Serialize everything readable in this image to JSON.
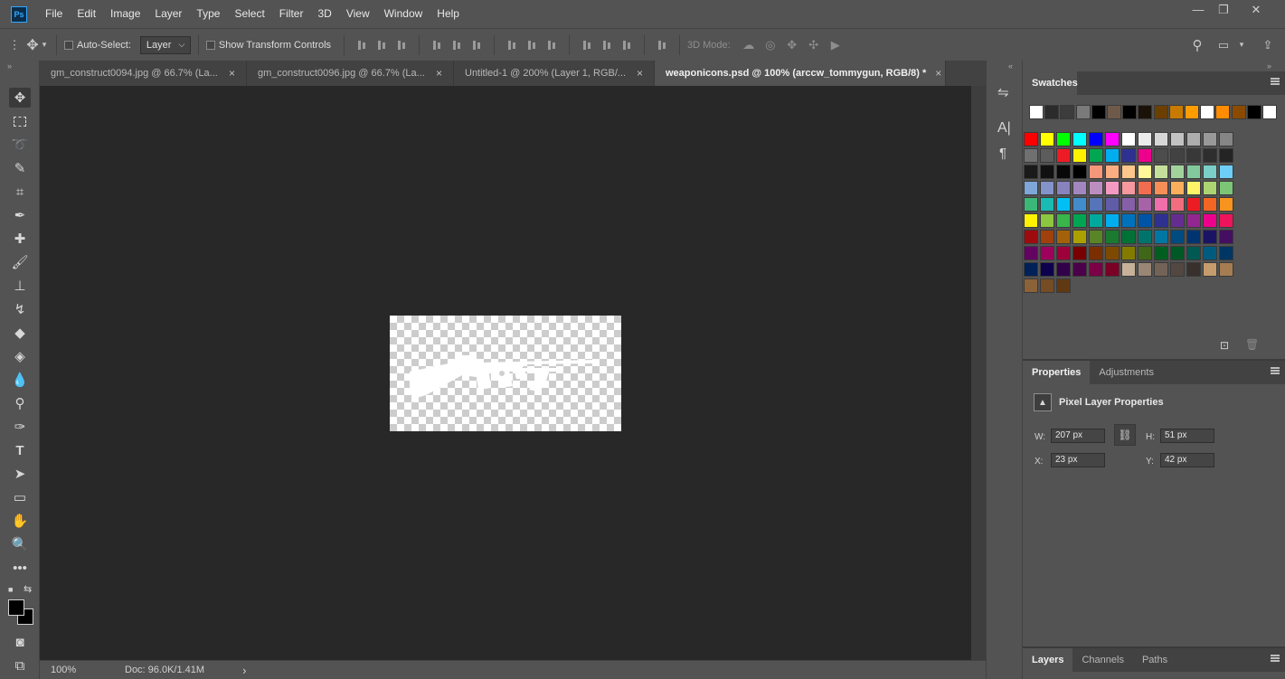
{
  "app": {
    "logo_text": "Ps"
  },
  "menu": [
    "File",
    "Edit",
    "Image",
    "Layer",
    "Type",
    "Select",
    "Filter",
    "3D",
    "View",
    "Window",
    "Help"
  ],
  "window_controls": {
    "minimize": "—",
    "restore": "❐",
    "close": "✕"
  },
  "options_bar": {
    "auto_select_label": "Auto-Select:",
    "auto_select_value": "Layer",
    "show_transform_label": "Show Transform Controls",
    "mode_3d_label": "3D Mode:"
  },
  "tabs": [
    {
      "label": "gm_construct0094.jpg @ 66.7% (La...",
      "close": "×"
    },
    {
      "label": "gm_construct0096.jpg @ 66.7% (La...",
      "close": "×"
    },
    {
      "label": "Untitled-1 @ 200% (Layer 1, RGB/...",
      "close": "×"
    },
    {
      "label": "weaponicons.psd @ 100% (arccw_tommygun, RGB/8) *",
      "close": "×"
    }
  ],
  "status": {
    "zoom": "100%",
    "doc": "Doc: 96.0K/1.41M",
    "arrow": "›"
  },
  "swatches_panel": {
    "tab": "Swatches",
    "recent": [
      "#ffffff",
      "#2b2b2b",
      "#3c3c3c",
      "#7a7a7a",
      "#000000",
      "#6f5a4a",
      "#000000",
      "#1a1208",
      "#6b3f00",
      "#c97a00",
      "#ff9c00",
      "#ffffff",
      "#ff8c00",
      "#8a4b00",
      "#000000",
      "#ffffff"
    ],
    "grid": [
      [
        "#ff0000",
        "#ffff00",
        "#00ff00",
        "#00ffff",
        "#0000ff",
        "#ff00ff",
        "#ffffff",
        "#ebebeb",
        "#d6d6d6",
        "#c2c2c2",
        "#adadad",
        "#999999",
        "#858585"
      ],
      [
        "#707070",
        "#5c5c5c",
        "#ed1c24",
        "#fff200",
        "#00a651",
        "#00aeef",
        "#2e3192",
        "#ec008c",
        "#4d4d4d",
        "#424242",
        "#383838",
        "#2e2e2e",
        "#242424"
      ],
      [
        "#1a1a1a",
        "#111111",
        "#080808",
        "#000000",
        "#f7977a",
        "#f9ad81",
        "#fdc68a",
        "#fff79a",
        "#c4df9b",
        "#a3d39c",
        "#82ca9d",
        "#7bcdc8",
        "#6ecff6"
      ],
      [
        "#7ea7d8",
        "#8493ca",
        "#8882be",
        "#a187be",
        "#bc8dbf",
        "#f49ac2",
        "#f6989d",
        "#f26c4f",
        "#f68e55",
        "#fbaf5c",
        "#fff467",
        "#acd372",
        "#7cc576"
      ],
      [
        "#3bb878",
        "#1abbb4",
        "#00bff3",
        "#438ccb",
        "#5574b9",
        "#605ca8",
        "#855fa8",
        "#a763a8",
        "#f06eaa",
        "#f26d7d",
        "#ed1c24",
        "#f26522",
        "#f7941d"
      ],
      [
        "#fff200",
        "#8dc63f",
        "#39b54a",
        "#00a651",
        "#00a99d",
        "#00aeef",
        "#0072bc",
        "#0054a6",
        "#2e3192",
        "#662d91",
        "#92278f",
        "#ec008c",
        "#ed145b"
      ],
      [
        "#9e0b0f",
        "#a0410d",
        "#a3620a",
        "#aba000",
        "#598527",
        "#1a7b30",
        "#007236",
        "#00746b",
        "#0076a3",
        "#004b80",
        "#003471",
        "#1b1464",
        "#440e62"
      ],
      [
        "#630460",
        "#9e005d",
        "#9e0039",
        "#790000",
        "#7b2e00",
        "#7d4900",
        "#827b00",
        "#406618",
        "#005e20",
        "#005826",
        "#005952",
        "#005b7f",
        "#003663"
      ],
      [
        "#002157",
        "#0d004c",
        "#32004b",
        "#4b0049",
        "#7b0046",
        "#7a0026",
        "#c7b299",
        "#998675",
        "#736357",
        "#534741",
        "#37302d",
        "#c69c6d",
        "#a67c52"
      ],
      [
        "#8c6239",
        "#754c24",
        "#603913",
        "",
        "",
        "",
        "",
        "",
        "",
        "",
        "",
        "",
        ""
      ]
    ]
  },
  "properties_panel": {
    "tabs": [
      "Properties",
      "Adjustments"
    ],
    "title": "Pixel Layer Properties",
    "w_label": "W:",
    "w": "207 px",
    "h_label": "H:",
    "h": "51 px",
    "x_label": "X:",
    "x": "23 px",
    "y_label": "Y:",
    "y": "42 px"
  },
  "layers_panel": {
    "tabs": [
      "Layers",
      "Channels",
      "Paths"
    ]
  }
}
